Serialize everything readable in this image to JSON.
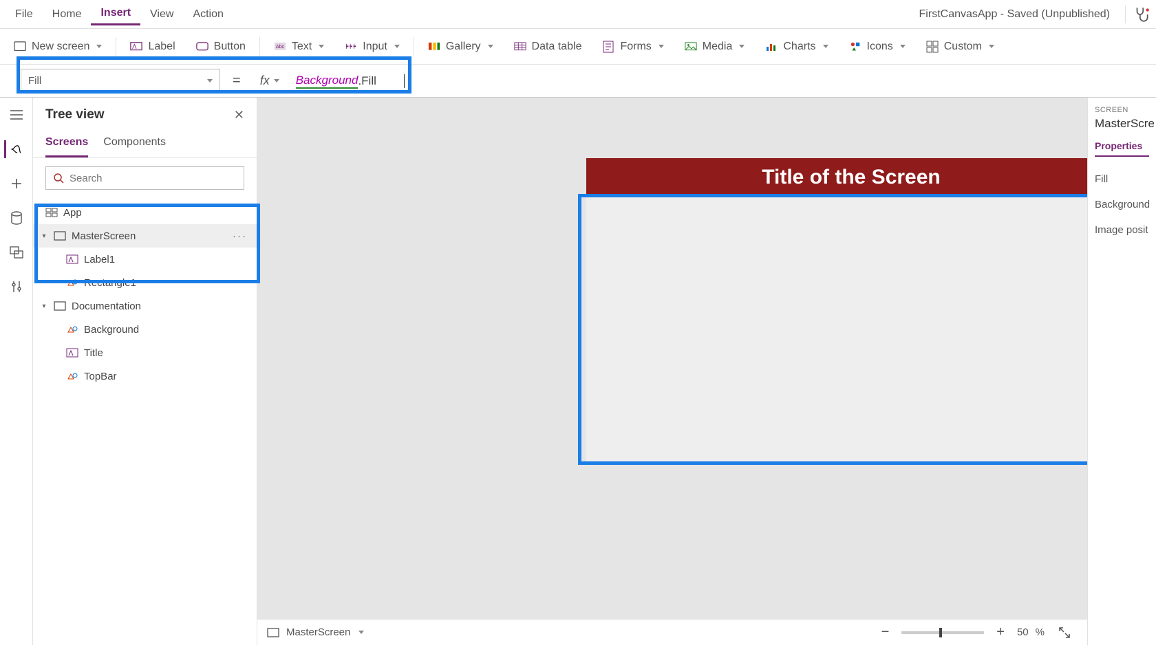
{
  "app_status": "FirstCanvasApp - Saved (Unpublished)",
  "menubar": {
    "file": "File",
    "home": "Home",
    "insert": "Insert",
    "view": "View",
    "action": "Action"
  },
  "ribbon": {
    "new_screen": "New screen",
    "label": "Label",
    "button": "Button",
    "text": "Text",
    "input": "Input",
    "gallery": "Gallery",
    "data_table": "Data table",
    "forms": "Forms",
    "media": "Media",
    "charts": "Charts",
    "icons": "Icons",
    "custom": "Custom"
  },
  "formula": {
    "property": "Fill",
    "equals": "=",
    "fx": "fx",
    "ref": "Background",
    "dot": ".",
    "prop": "Fill"
  },
  "treeview": {
    "title": "Tree view",
    "tabs": {
      "screens": "Screens",
      "components": "Components"
    },
    "search_placeholder": "Search",
    "nodes": {
      "app": "App",
      "master": "MasterScreen",
      "label1": "Label1",
      "rect1": "Rectangle1",
      "doc": "Documentation",
      "background": "Background",
      "title": "Title",
      "topbar": "TopBar"
    }
  },
  "canvas": {
    "screen_title": "Title of the Screen"
  },
  "statusbar": {
    "current": "MasterScreen",
    "zoom": "50",
    "pct": "%"
  },
  "props": {
    "section": "SCREEN",
    "object": "MasterScre",
    "tab": "Properties",
    "p_fill": "Fill",
    "p_bg": "Background",
    "p_imgpos": "Image posit"
  }
}
